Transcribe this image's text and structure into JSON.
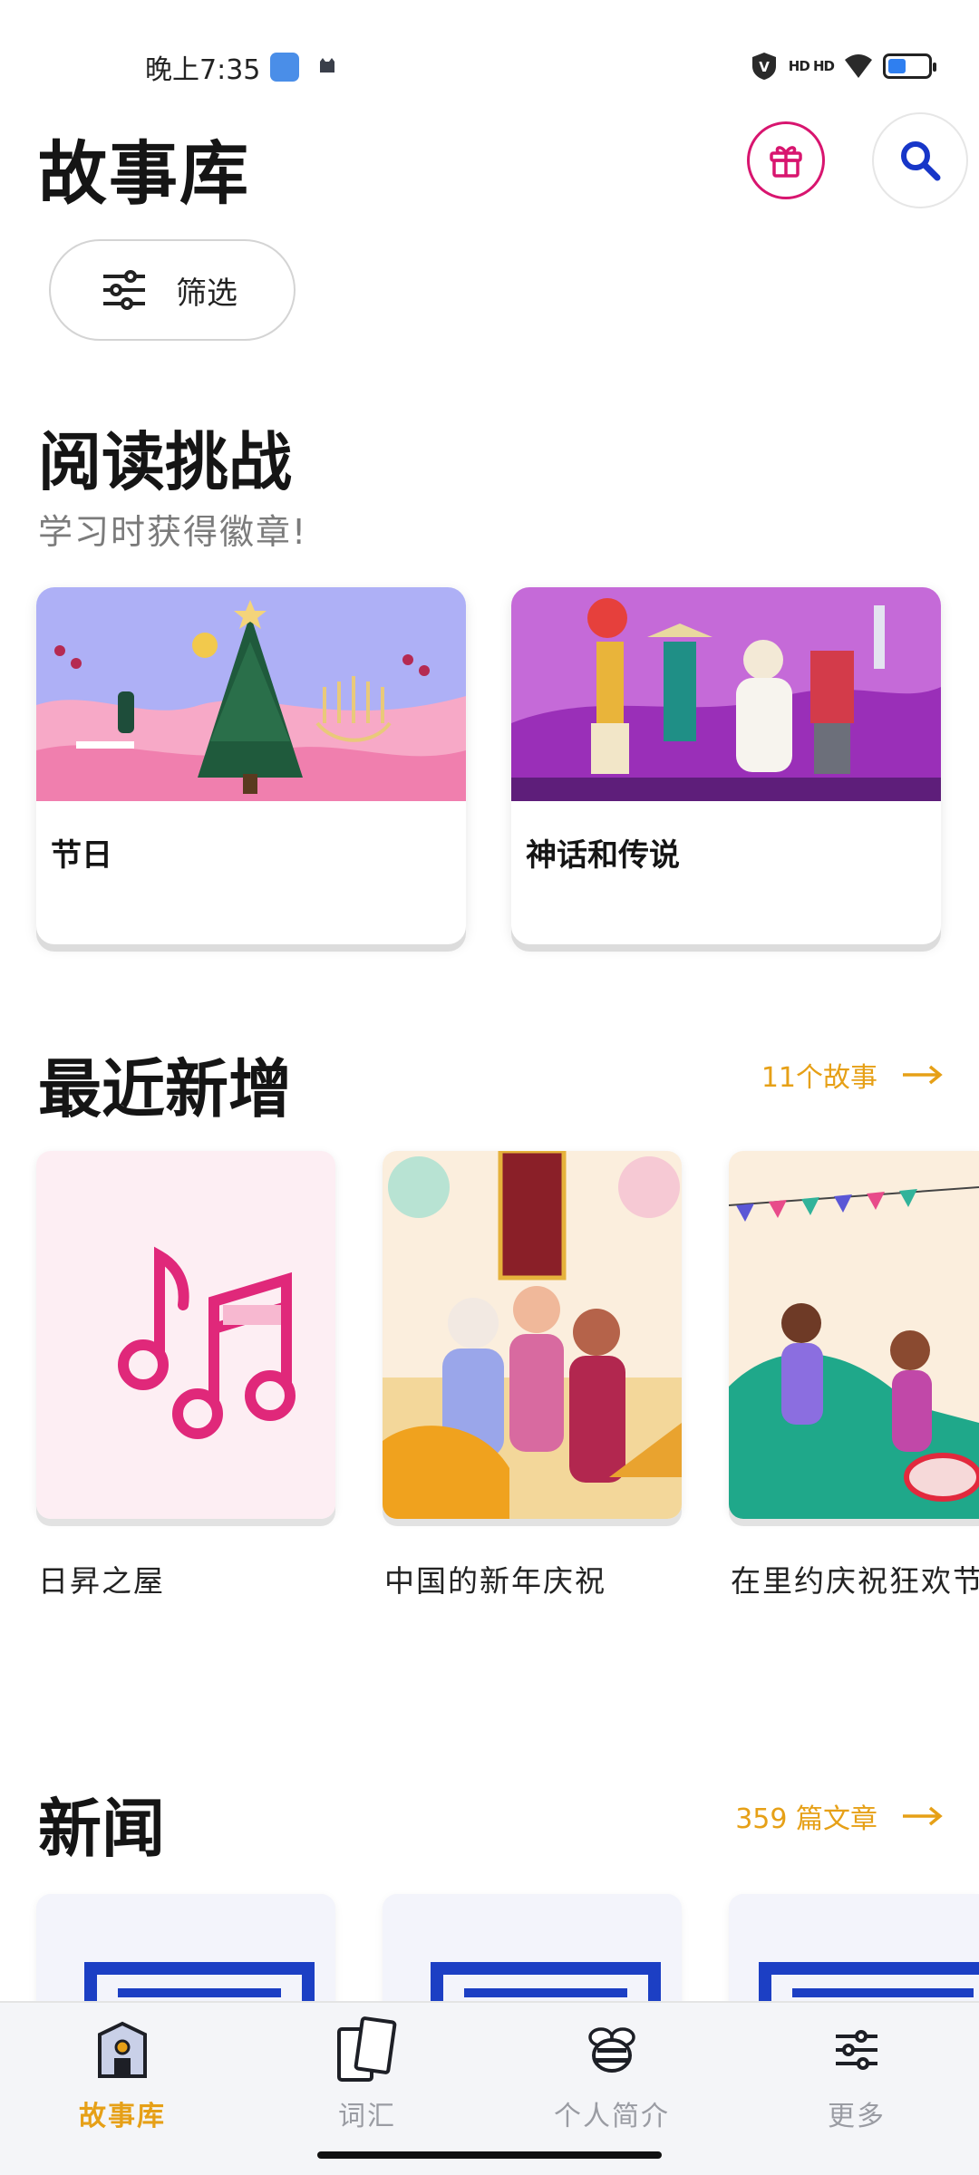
{
  "status_bar": {
    "time": "晚上7:35",
    "signal_label": "HD HD"
  },
  "header": {
    "title": "故事库",
    "filter_label": "筛选"
  },
  "reading_challenge": {
    "title": "阅读挑战",
    "subtitle": "学习时获得徽章!",
    "cards": [
      {
        "label": "节日"
      },
      {
        "label": "神话和传说"
      }
    ]
  },
  "recently_added": {
    "title": "最近新增",
    "link_label": "11个故事",
    "items": [
      {
        "label": "日昇之屋"
      },
      {
        "label": "中国的新年庆祝"
      },
      {
        "label": "在里约庆祝狂欢节"
      }
    ]
  },
  "news": {
    "title": "新闻",
    "link_label": "359 篇文章"
  },
  "bottom_nav": {
    "items": [
      {
        "label": "故事库",
        "active": true
      },
      {
        "label": "词汇",
        "active": false
      },
      {
        "label": "个人简介",
        "active": false
      },
      {
        "label": "更多",
        "active": false
      }
    ]
  },
  "colors": {
    "accent": "#e6a017",
    "gift": "#d8156f",
    "search": "#1736c8",
    "battery": "#2f7ff0"
  }
}
